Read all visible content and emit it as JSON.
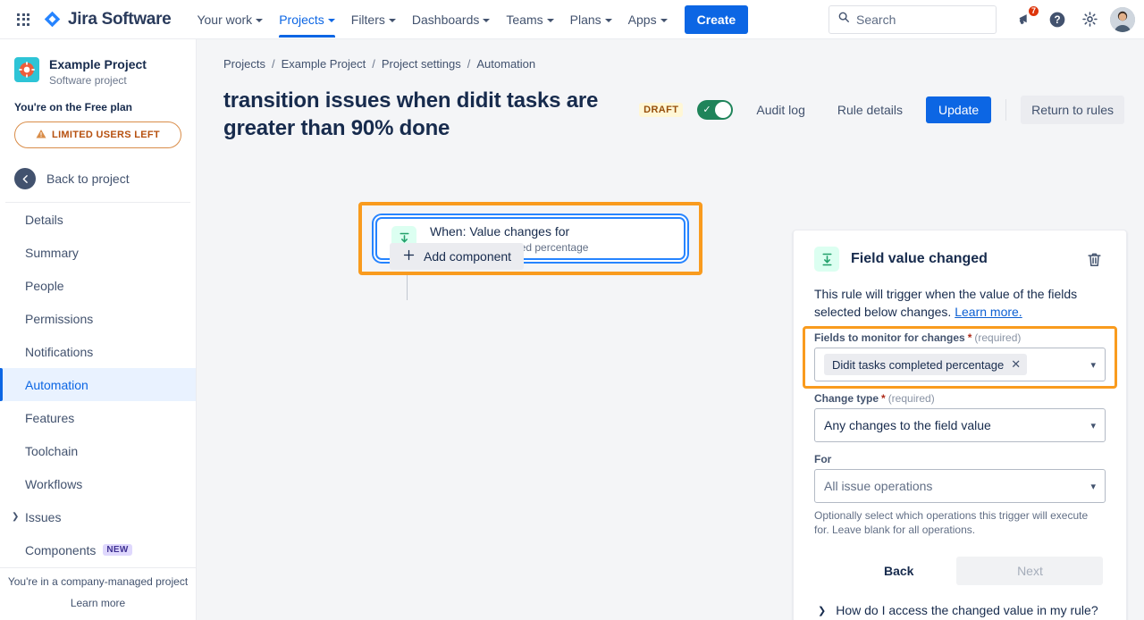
{
  "topnav": {
    "app_switcher": "apps-grid-icon",
    "brand": "Jira Software",
    "items": [
      {
        "label": "Your work",
        "has_caret": true,
        "active": false
      },
      {
        "label": "Projects",
        "has_caret": true,
        "active": true
      },
      {
        "label": "Filters",
        "has_caret": true,
        "active": false
      },
      {
        "label": "Dashboards",
        "has_caret": true,
        "active": false
      },
      {
        "label": "Teams",
        "has_caret": true,
        "active": false
      },
      {
        "label": "Plans",
        "has_caret": true,
        "active": false
      },
      {
        "label": "Apps",
        "has_caret": true,
        "active": false
      }
    ],
    "create_label": "Create",
    "search_placeholder": "Search",
    "search_value": "",
    "notification_count": "7",
    "help_icon": "help-circle-icon",
    "settings_icon": "gear-icon",
    "avatar": "user-avatar"
  },
  "sidebar": {
    "project_name": "Example Project",
    "project_type": "Software project",
    "plan_line": "You're on the Free plan",
    "limited_users_label": "LIMITED USERS LEFT",
    "back_label": "Back to project",
    "items": [
      {
        "label": "Details",
        "selected": false,
        "expandable": false,
        "badge": ""
      },
      {
        "label": "Summary",
        "selected": false,
        "expandable": false,
        "badge": ""
      },
      {
        "label": "People",
        "selected": false,
        "expandable": false,
        "badge": ""
      },
      {
        "label": "Permissions",
        "selected": false,
        "expandable": false,
        "badge": ""
      },
      {
        "label": "Notifications",
        "selected": false,
        "expandable": false,
        "badge": ""
      },
      {
        "label": "Automation",
        "selected": true,
        "expandable": false,
        "badge": ""
      },
      {
        "label": "Features",
        "selected": false,
        "expandable": false,
        "badge": ""
      },
      {
        "label": "Toolchain",
        "selected": false,
        "expandable": false,
        "badge": ""
      },
      {
        "label": "Workflows",
        "selected": false,
        "expandable": false,
        "badge": ""
      },
      {
        "label": "Issues",
        "selected": false,
        "expandable": true,
        "badge": ""
      },
      {
        "label": "Components",
        "selected": false,
        "expandable": false,
        "badge": "NEW"
      }
    ],
    "footer_line1": "You're in a company-managed project",
    "footer_line2": "Learn more"
  },
  "breadcrumb": [
    "Projects",
    "Example Project",
    "Project settings",
    "Automation"
  ],
  "header": {
    "rule_title": "transition issues when didit tasks are greater than 90% done",
    "status_label": "DRAFT",
    "toggle_on": true,
    "audit_log": "Audit log",
    "rule_details": "Rule details",
    "update": "Update",
    "return_to_rules": "Return to rules"
  },
  "canvas": {
    "trigger_icon": "field-value-changed-icon",
    "trigger_title": "When: Value changes for",
    "trigger_subtitle": "Didit tasks completed percentage",
    "add_component_label": "Add component"
  },
  "panel": {
    "icon": "field-value-changed-icon",
    "title": "Field value changed",
    "delete_icon": "trash-icon",
    "description": "This rule will trigger when the value of the fields selected below changes.",
    "learn_more": "Learn more.",
    "fields_label": "Fields to monitor for changes",
    "fields_required": "(required)",
    "fields_chip": "Didit tasks completed percentage",
    "change_type_label": "Change type",
    "change_type_required": "(required)",
    "change_type_value": "Any changes to the field value",
    "for_label": "For",
    "for_placeholder": "All issue operations",
    "for_hint": "Optionally select which operations this trigger will execute for. Leave blank for all operations.",
    "back_label": "Back",
    "next_label": "Next",
    "disclosure_label": "How do I access the changed value in my rule?"
  },
  "colors": {
    "brand_blue": "#0c66e4",
    "highlight_orange": "#f99b1e",
    "focus_blue": "#2684ff",
    "success_green": "#1f845a",
    "draft_amber": "#974f0c",
    "canvas_bg": "#f4f5f7"
  }
}
